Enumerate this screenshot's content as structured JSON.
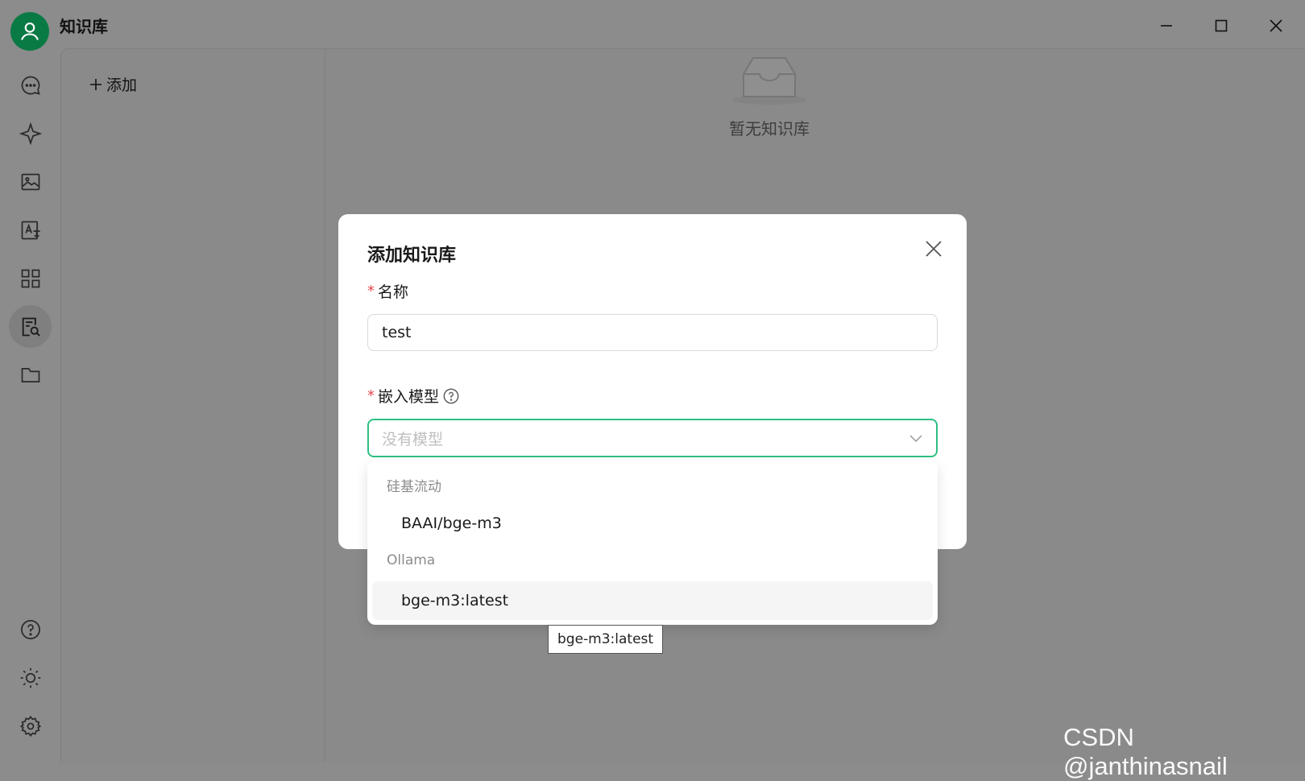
{
  "app": {
    "title": "知识库"
  },
  "window_controls": [
    "minimize-icon",
    "maximize-icon",
    "close-icon"
  ],
  "rail": [
    {
      "icon": "chat-icon",
      "active": false
    },
    {
      "icon": "sparkle-icon",
      "active": false
    },
    {
      "icon": "image-icon",
      "active": false
    },
    {
      "icon": "translate-icon",
      "active": false
    },
    {
      "icon": "apps-grid-icon",
      "active": false
    },
    {
      "icon": "knowledge-search-icon",
      "active": true
    },
    {
      "icon": "folder-icon",
      "active": false
    },
    {
      "icon": "help-icon",
      "active": false
    },
    {
      "icon": "theme-sun-icon",
      "active": false
    },
    {
      "icon": "settings-gear-icon",
      "active": false
    }
  ],
  "sidebar": {
    "add_label": "添加"
  },
  "empty_state": {
    "text": "暂无知识库"
  },
  "modal": {
    "title": "添加知识库",
    "name_label": "名称",
    "name_value": "test",
    "embed_label": "嵌入模型",
    "embed_placeholder": "没有模型"
  },
  "dropdown": {
    "groups": [
      {
        "label": "硅基流动",
        "options": [
          "BAAI/bge-m3"
        ]
      },
      {
        "label": "Ollama",
        "options": [
          "bge-m3:latest"
        ]
      }
    ],
    "hovered": "bge-m3:latest"
  },
  "tooltip": {
    "text": "bge-m3:latest"
  },
  "watermark": "CSDN @janthinasnail",
  "colors": {
    "accent": "#2fbf83",
    "required": "#e5484d",
    "avatar": "#0a7a45"
  }
}
